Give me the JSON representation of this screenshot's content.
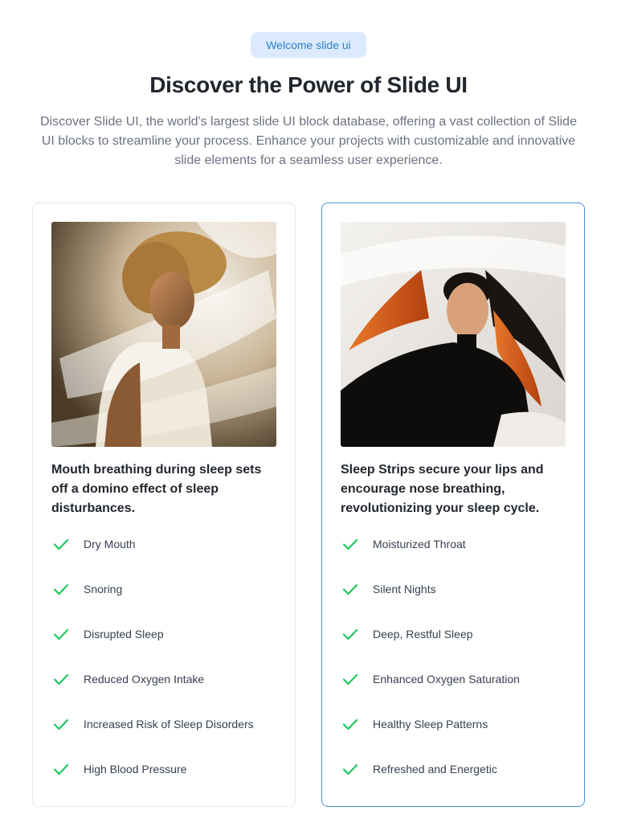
{
  "header": {
    "badge": "Welcome slide ui",
    "title": "Discover the Power of Slide UI",
    "subtitle": "Discover Slide UI, the world's largest slide UI block database, offering a vast collection of Slide UI blocks to streamline your process. Enhance your projects with customizable and innovative slide elements for a seamless user experience."
  },
  "cards": [
    {
      "image": "woman-curly-hair-white-fabric-photo",
      "heading": "Mouth breathing during sleep sets off a domino effect of sleep disturbances.",
      "features": [
        "Dry Mouth",
        "Snoring",
        "Disrupted Sleep",
        "Reduced Oxygen Intake",
        "Increased Risk of Sleep Disorders",
        "High Blood Pressure"
      ]
    },
    {
      "image": "woman-flowing-hair-black-top-photo",
      "heading": "Sleep Strips secure your lips and encourage nose breathing, revolutionizing your sleep cycle.",
      "features": [
        "Moisturized Throat",
        "Silent Nights",
        "Deep, Restful Sleep",
        "Enhanced Oxygen Saturation",
        "Healthy Sleep Patterns",
        "Refreshed and Energetic"
      ]
    }
  ],
  "colors": {
    "accent": "#4a90e2",
    "badge_bg": "#dbeafe",
    "check": "#22c55e"
  },
  "icons": {
    "feature_marker": "check-icon"
  }
}
